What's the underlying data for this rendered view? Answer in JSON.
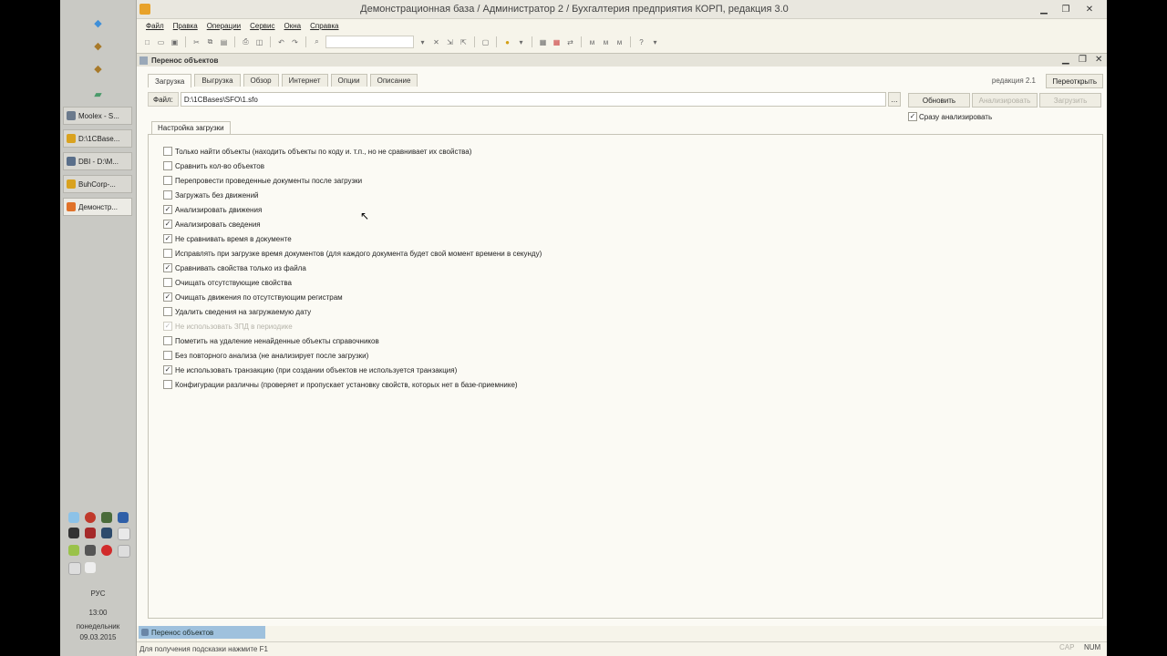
{
  "taskbar": {
    "windows": [
      "Moolex - S...",
      "D:\\1CBase...",
      "DBI - D:\\M...",
      "BuhCorp-...",
      "Демонстр..."
    ],
    "language": "РУС",
    "time": "13:00",
    "weekday": "понедельник",
    "date": "09.03.2015"
  },
  "app": {
    "title": "Демонстрационная база / Администратор 2 / Бухгалтерия предприятия КОРП, редакция 3.0",
    "menu": [
      "Файл",
      "Правка",
      "Операции",
      "Сервис",
      "Окна",
      "Справка"
    ]
  },
  "doc": {
    "title": "Перенос объектов",
    "tabs": [
      "Загрузка",
      "Выгрузка",
      "Обзор",
      "Интернет",
      "Опции",
      "Описание"
    ],
    "revision": "редакция 2.1",
    "reconnect_label": "Переоткрыть",
    "file_label": "Файл:",
    "file_path": "D:\\1CBases\\SFO\\1.sfo",
    "refresh_label": "Обновить",
    "analyze_label": "Анализировать",
    "load_label": "Загрузить",
    "instant_analyze_label": "Сразу анализировать",
    "settings_tab": "Настройка загрузки",
    "options": [
      {
        "label": "Только найти объекты (находить объекты по коду и. т.п., но не сравнивает их свойства)",
        "checked": false,
        "disabled": false
      },
      {
        "label": "Сравнить кол-во объектов",
        "checked": false,
        "disabled": false
      },
      {
        "label": "Перепровести проведенные документы после загрузки",
        "checked": false,
        "disabled": false
      },
      {
        "label": "Загружать без движений",
        "checked": false,
        "disabled": false
      },
      {
        "label": "Анализировать движения",
        "checked": true,
        "disabled": false
      },
      {
        "label": "Анализировать сведения",
        "checked": true,
        "disabled": false
      },
      {
        "label": "Не сравнивать время в документе",
        "checked": true,
        "disabled": false
      },
      {
        "label": "Исправлять при загрузке время документов (для каждого документа будет свой момент времени в секунду)",
        "checked": false,
        "disabled": false
      },
      {
        "label": "Сравнивать свойства только из файла",
        "checked": true,
        "disabled": false
      },
      {
        "label": "Очищать отсутствующие свойства",
        "checked": false,
        "disabled": false
      },
      {
        "label": "Очищать движения по отсутствующим регистрам",
        "checked": true,
        "disabled": false
      },
      {
        "label": "Удалить сведения на загружаемую дату",
        "checked": false,
        "disabled": false
      },
      {
        "label": "Не использовать ЗПД в периодике",
        "checked": true,
        "disabled": true
      },
      {
        "label": "Пометить на удаление ненайденные объекты справочников",
        "checked": false,
        "disabled": false
      },
      {
        "label": "Без повторного анализа (не анализирует после загрузки)",
        "checked": false,
        "disabled": false
      },
      {
        "label": "Не использовать транзакцию (при создании объектов не используется транзакция)",
        "checked": true,
        "disabled": false
      },
      {
        "label": "Конфигурации различны (проверяет и пропускает установку свойств, которых нет в базе-приемнике)",
        "checked": false,
        "disabled": false
      }
    ]
  },
  "bottom": {
    "window_tab": "Перенос объектов",
    "status_hint": "Для получения подсказки нажмите F1",
    "cap": "CAP",
    "num": "NUM"
  }
}
